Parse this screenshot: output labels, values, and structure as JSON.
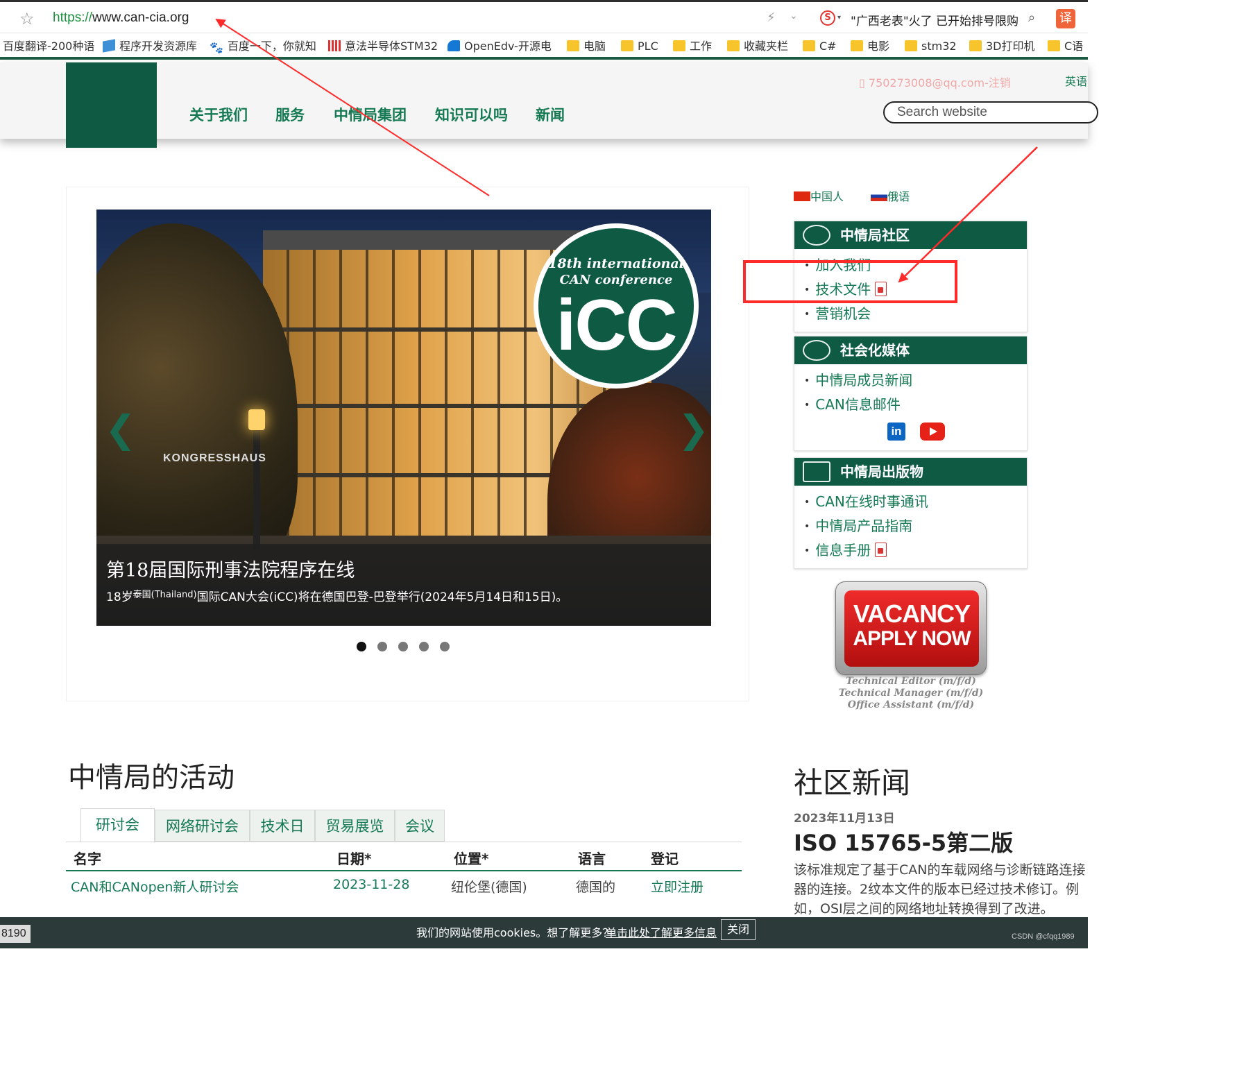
{
  "browser": {
    "url_scheme": "https://",
    "url_host": "www.can-cia.org",
    "hot_search": "\"广西老表\"火了 已开始排号限购",
    "translate_label": "译",
    "sogou_label": "S",
    "bookmarks": [
      {
        "label": "百度翻译-200种语",
        "icon": "none"
      },
      {
        "label": "程序开发资源库",
        "icon": "cube-icon"
      },
      {
        "label": "百度一下，你就知",
        "icon": "paw-icon"
      },
      {
        "label": "意法半导体STM32",
        "icon": "st-icon"
      },
      {
        "label": "OpenEdv-开源电",
        "icon": "openedv-icon"
      },
      {
        "label": "电脑",
        "icon": "folder-icon"
      },
      {
        "label": "PLC",
        "icon": "folder-icon"
      },
      {
        "label": "工作",
        "icon": "folder-icon"
      },
      {
        "label": "收藏夹栏",
        "icon": "folder-icon"
      },
      {
        "label": "C#",
        "icon": "folder-icon"
      },
      {
        "label": "电影",
        "icon": "folder-icon"
      },
      {
        "label": "stm32",
        "icon": "folder-icon"
      },
      {
        "label": "3D打印机",
        "icon": "folder-icon"
      },
      {
        "label": "C语",
        "icon": "folder-icon"
      }
    ]
  },
  "header": {
    "nav": [
      "关于我们",
      "服务",
      "中情局集团",
      "知识可以吗",
      "新闻"
    ],
    "user_link": "750273008@qq.com-注销",
    "lang_link": "英语",
    "search_placeholder": "Search website"
  },
  "carousel": {
    "badge_line1": "18th international",
    "badge_line2": "CAN conference",
    "badge_logo": "iCC",
    "building_sign": "KONGRESSHAUS",
    "title": "第18届国际刑事法院程序在线",
    "text_prefix": "18岁",
    "text_sup": "泰国(Thailand)",
    "text_rest": "国际CAN大会(iCC)将在德国巴登-巴登举行(2024年5月14日和15日)。",
    "dots": 5,
    "active_dot": 0,
    "prev_arrow": "❮",
    "next_arrow": "❯"
  },
  "sidebar": {
    "languages": [
      "中国人",
      "俄语"
    ],
    "community": {
      "title": "中情局社区",
      "items": [
        "加入我们",
        "技术文件",
        "营销机会"
      ]
    },
    "social": {
      "title": "社会化媒体",
      "items": [
        "中情局成员新闻",
        "CAN信息邮件"
      ],
      "linkedin": "in"
    },
    "publications": {
      "title": "中情局出版物",
      "items": [
        "CAN在线时事通讯",
        "中情局产品指南",
        "信息手册"
      ]
    },
    "vacancy": {
      "line1": "VACANCY",
      "line2": "APPLY NOW",
      "roles": [
        "Technical Editor (m/f/d)",
        "Technical Manager (m/f/d)",
        "Office Assistant (m/f/d)"
      ]
    }
  },
  "activities": {
    "title": "中情局的活动",
    "tabs": [
      "研讨会",
      "网络研讨会",
      "技术日",
      "贸易展览",
      "会议"
    ],
    "columns": [
      "名字",
      "日期*",
      "位置*",
      "语言",
      "登记"
    ],
    "rows": [
      [
        "CAN和CANopen新人研讨会",
        "2023-11-28",
        "纽伦堡(德国)",
        "德国的",
        "立即注册"
      ]
    ]
  },
  "news": {
    "title": "社区新闻",
    "date": "2023年11月13日",
    "headline": "ISO 15765-5第二版",
    "body": "该标准规定了基于CAN的车载网络与诊断链路连接器的连接。2纹本文件的版本已经过技术修订。例如，OSI层之间的网络地址转换得到了改进。"
  },
  "cookie": {
    "text": "我们的网站使用cookies。想了解更多？",
    "link": "单击此处了解更多信息",
    "close": "关闭"
  },
  "page_number": "8190",
  "watermark": "CSDN @cfqq1989",
  "annotation_color": "#ff2a2a"
}
